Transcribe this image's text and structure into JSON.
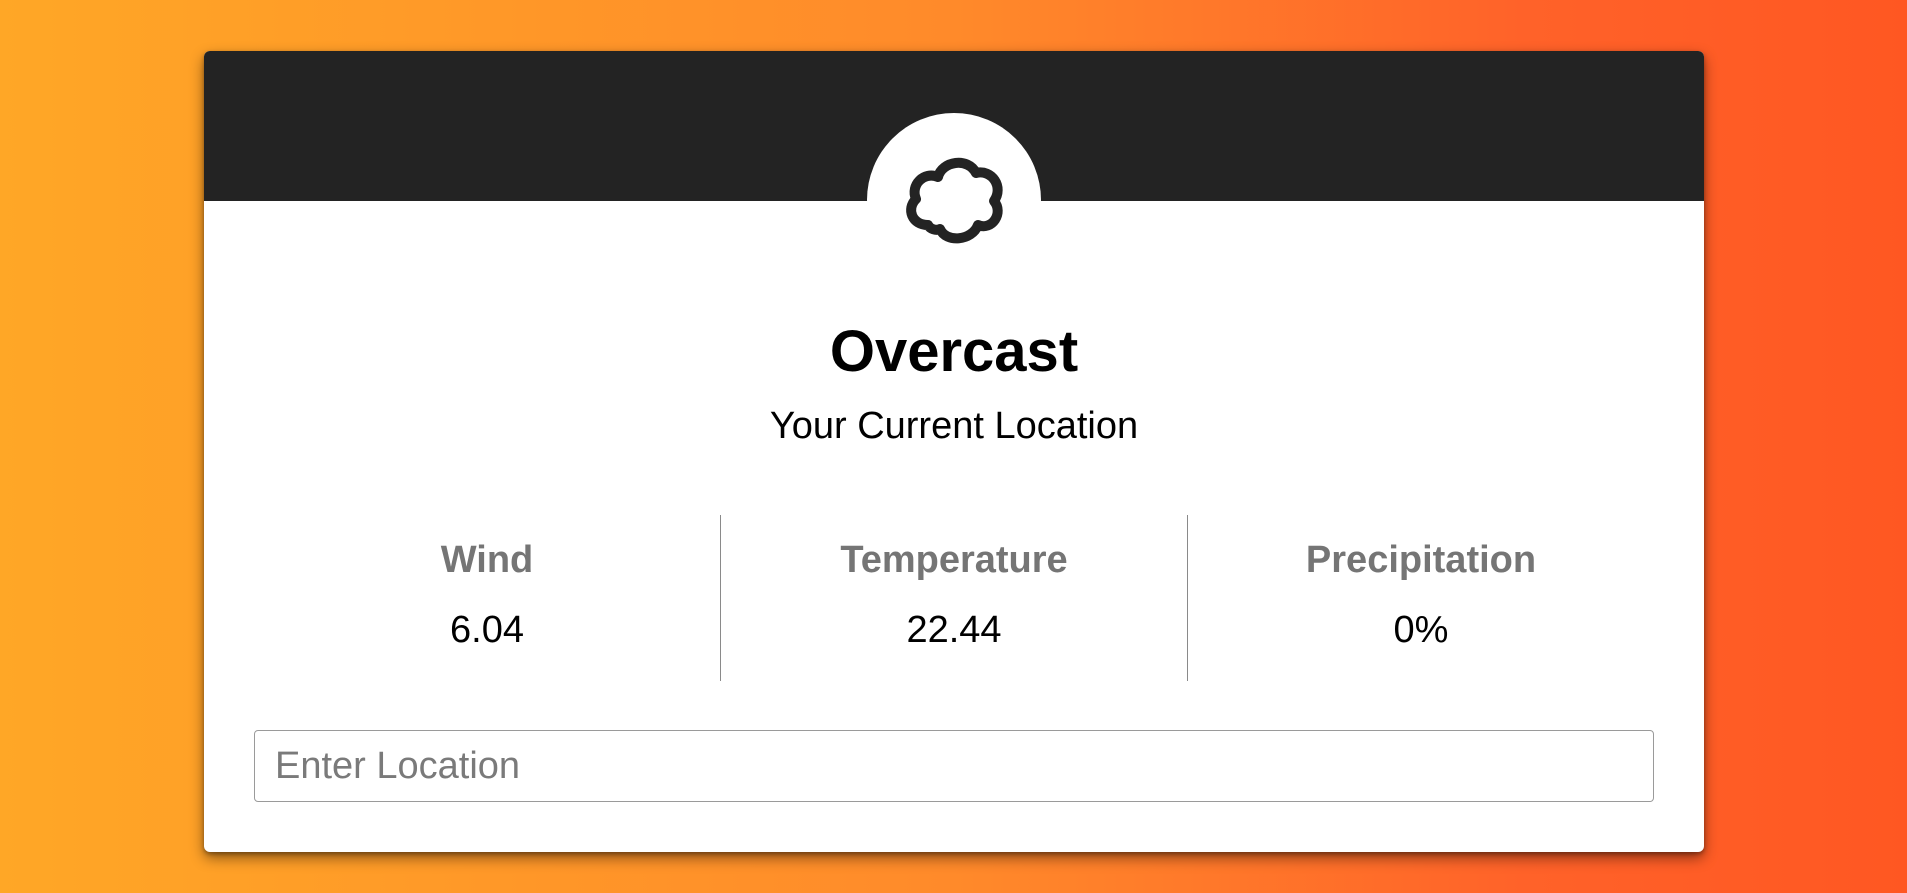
{
  "weather": {
    "icon": "cloud-icon",
    "condition": "Overcast",
    "location": "Your Current Location"
  },
  "stats": [
    {
      "label": "Wind",
      "value": "6.04"
    },
    {
      "label": "Temperature",
      "value": "22.44"
    },
    {
      "label": "Precipitation",
      "value": "0%"
    }
  ],
  "search": {
    "value": "",
    "placeholder": "Enter Location"
  },
  "colors": {
    "header": "#232323",
    "background_start": "#ffa726",
    "background_end": "#ff5722",
    "label": "#757575"
  }
}
